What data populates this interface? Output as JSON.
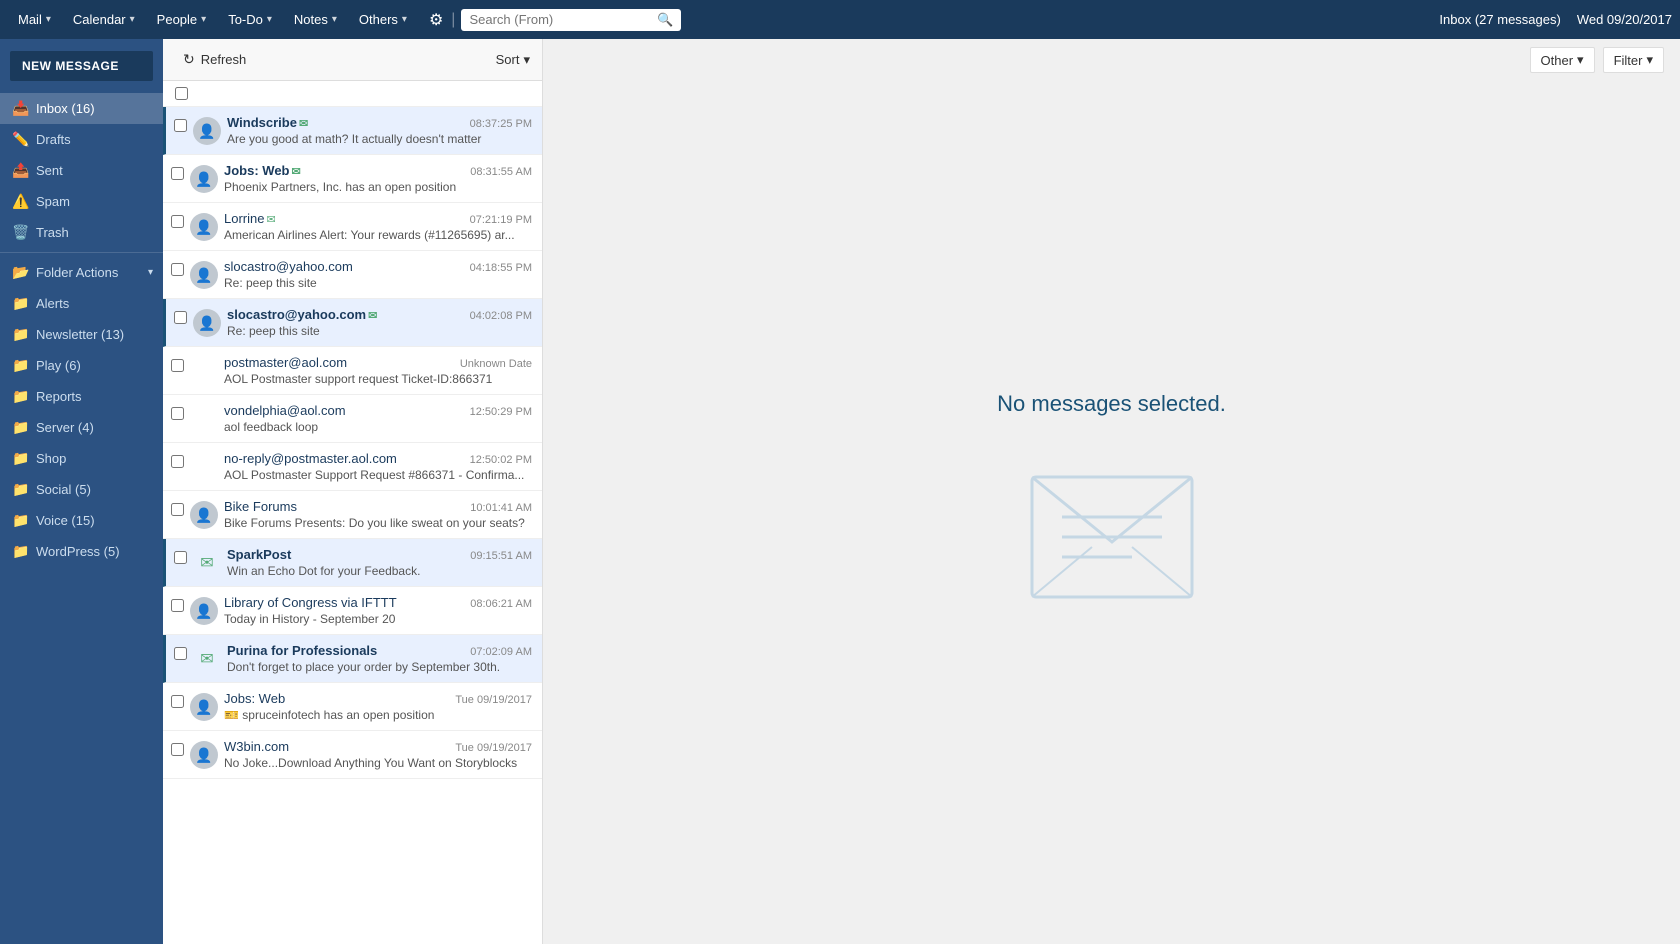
{
  "topnav": {
    "mail_label": "Mail",
    "calendar_label": "Calendar",
    "people_label": "People",
    "todo_label": "To-Do",
    "notes_label": "Notes",
    "others_label": "Others",
    "search_placeholder": "Search (From)",
    "inbox_status": "Inbox (27 messages)",
    "date": "Wed 09/20/2017"
  },
  "sidebar": {
    "new_message": "NEW MESSAGE",
    "items": [
      {
        "label": "Inbox (16)",
        "icon": "📥",
        "badge": ""
      },
      {
        "label": "Drafts",
        "icon": "✏️",
        "badge": ""
      },
      {
        "label": "Sent",
        "icon": "📤",
        "badge": ""
      },
      {
        "label": "Spam",
        "icon": "⚠️",
        "badge": ""
      },
      {
        "label": "Trash",
        "icon": "🗑️",
        "badge": ""
      }
    ],
    "folder_actions": "Folder Actions",
    "folders": [
      {
        "label": "Alerts",
        "icon": "📁",
        "badge": ""
      },
      {
        "label": "Newsletter (13)",
        "icon": "📁",
        "badge": ""
      },
      {
        "label": "Play (6)",
        "icon": "📁",
        "badge": ""
      },
      {
        "label": "Reports",
        "icon": "📁",
        "badge": ""
      },
      {
        "label": "Server (4)",
        "icon": "📁",
        "badge": ""
      },
      {
        "label": "Shop",
        "icon": "📁",
        "badge": ""
      },
      {
        "label": "Social (5)",
        "icon": "📁",
        "badge": ""
      },
      {
        "label": "Voice (15)",
        "icon": "📁",
        "badge": ""
      },
      {
        "label": "WordPress (5)",
        "icon": "📁",
        "badge": ""
      }
    ]
  },
  "email_list": {
    "refresh_label": "Refresh",
    "sort_label": "Sort",
    "emails": [
      {
        "sender": "Windscribe",
        "time": "08:37:25 PM",
        "preview": "Are you good at math? It actually doesn't matter",
        "avatar_type": "person_mail",
        "highlighted": true,
        "unread": true
      },
      {
        "sender": "Jobs: Web",
        "time": "08:31:55 AM",
        "preview": "Phoenix Partners, Inc. has an open position",
        "avatar_type": "person_mail",
        "highlighted": false,
        "unread": true
      },
      {
        "sender": "Lorrine",
        "time": "07:21:19 PM",
        "preview": "American Airlines Alert: Your rewards (#11265695) ar...",
        "avatar_type": "person_mail",
        "highlighted": false,
        "unread": false
      },
      {
        "sender": "slocastro@yahoo.com",
        "time": "04:18:55 PM",
        "preview": "Re: peep this site",
        "avatar_type": "person",
        "highlighted": false,
        "unread": false
      },
      {
        "sender": "slocastro@yahoo.com",
        "time": "04:02:08 PM",
        "preview": "Re: peep this site",
        "avatar_type": "person_mail",
        "highlighted": true,
        "unread": true
      },
      {
        "sender": "postmaster@aol.com",
        "time": "Unknown Date",
        "preview": "AOL Postmaster support request Ticket-ID:866371",
        "avatar_type": "none",
        "highlighted": false,
        "unread": false
      },
      {
        "sender": "vondelphia@aol.com",
        "time": "12:50:29 PM",
        "preview": "aol feedback loop",
        "avatar_type": "none",
        "highlighted": false,
        "unread": false
      },
      {
        "sender": "no-reply@postmaster.aol.com",
        "time": "12:50:02 PM",
        "preview": "AOL Postmaster Support Request #866371 - Confirma...",
        "avatar_type": "none",
        "highlighted": false,
        "unread": false
      },
      {
        "sender": "Bike Forums",
        "time": "10:01:41 AM",
        "preview": "Bike Forums Presents: Do you like sweat on your seats?",
        "avatar_type": "person",
        "highlighted": false,
        "unread": false
      },
      {
        "sender": "SparkPost",
        "time": "09:15:51 AM",
        "preview": "Win an Echo Dot for your Feedback.",
        "avatar_type": "mail",
        "highlighted": true,
        "unread": true
      },
      {
        "sender": "Library of Congress via IFTTT",
        "time": "08:06:21 AM",
        "preview": "Today in History - September 20",
        "avatar_type": "person",
        "highlighted": false,
        "unread": false
      },
      {
        "sender": "Purina for Professionals",
        "time": "07:02:09 AM",
        "preview": "Don't forget to place your order by September 30th.",
        "avatar_type": "mail",
        "highlighted": true,
        "unread": true
      },
      {
        "sender": "Jobs: Web",
        "time": "Tue 09/19/2017",
        "preview": "🎫 spruceinfotech has an open position",
        "avatar_type": "person",
        "highlighted": false,
        "unread": false
      },
      {
        "sender": "W3bin.com",
        "time": "Tue 09/19/2017",
        "preview": "No Joke...Download Anything You Want on Storyblocks",
        "avatar_type": "person",
        "highlighted": false,
        "unread": false
      }
    ]
  },
  "reading_pane": {
    "other_label": "Other",
    "filter_label": "Filter",
    "no_messages": "No messages selected."
  }
}
